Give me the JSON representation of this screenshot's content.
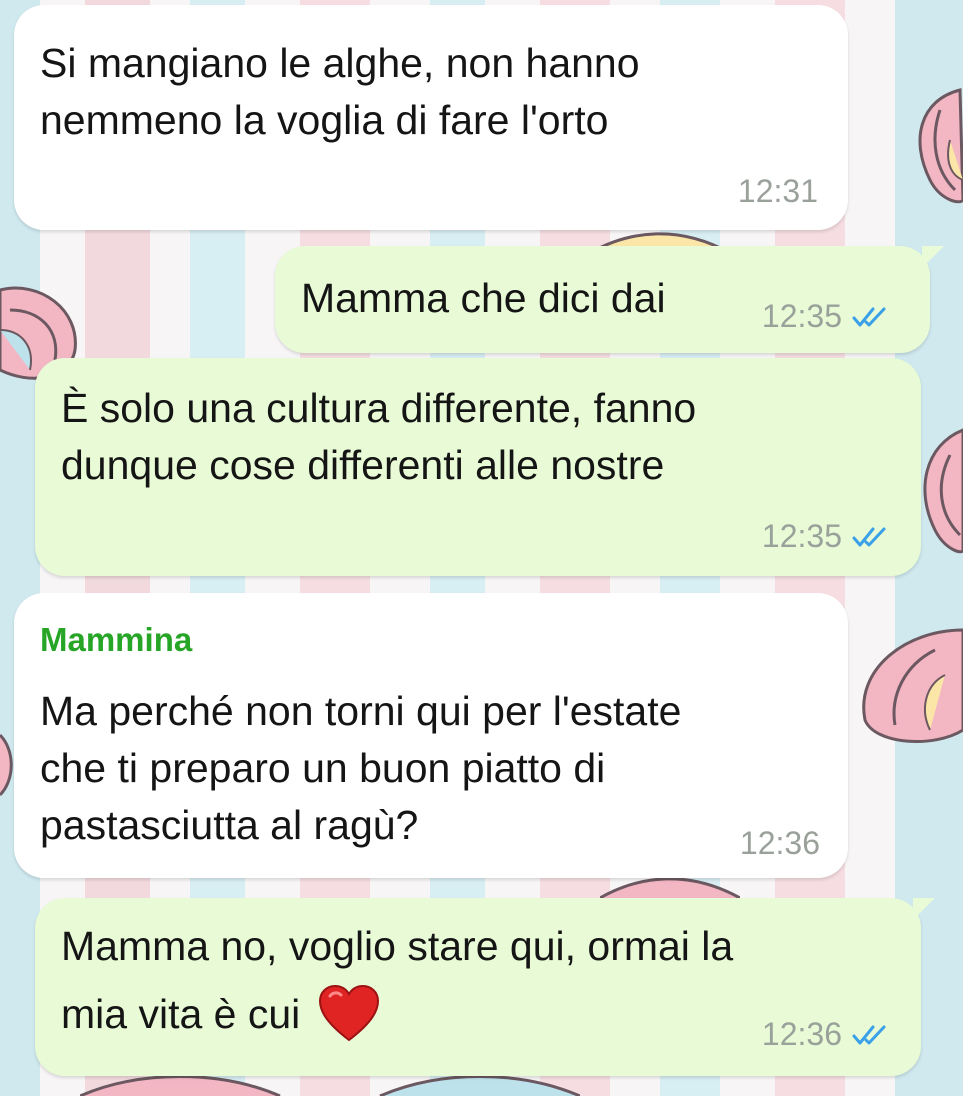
{
  "chat": {
    "messages": [
      {
        "direction": "incoming",
        "sender": "",
        "lines": [
          "Si mangiano le alghe, non hanno",
          "nemmeno la voglia di fare l'orto"
        ],
        "time": "12:31"
      },
      {
        "direction": "outgoing",
        "lines": [
          "Mamma che dici dai"
        ],
        "time": "12:35",
        "status": "read"
      },
      {
        "direction": "outgoing",
        "lines": [
          "È solo una cultura differente, fanno",
          "dunque cose differenti alle nostre"
        ],
        "time": "12:35",
        "status": "read"
      },
      {
        "direction": "incoming",
        "sender": "Mammina",
        "lines": [
          "Ma perché non torni qui per l'estate",
          "che ti preparo un buon piatto di",
          "pastasciutta al ragù?"
        ],
        "time": "12:36"
      },
      {
        "direction": "outgoing",
        "lines": [
          "Mamma no, voglio stare qui, ormai la",
          "mia vita è cui"
        ],
        "emoji": "red-heart",
        "time": "12:36",
        "status": "read"
      }
    ]
  },
  "colors": {
    "incoming_bubble": "#ffffff",
    "outgoing_bubble": "#e8fbd6",
    "sender_name": "#27a527",
    "read_ticks": "#3aa0e8",
    "timestamp": "#9aa19a"
  }
}
